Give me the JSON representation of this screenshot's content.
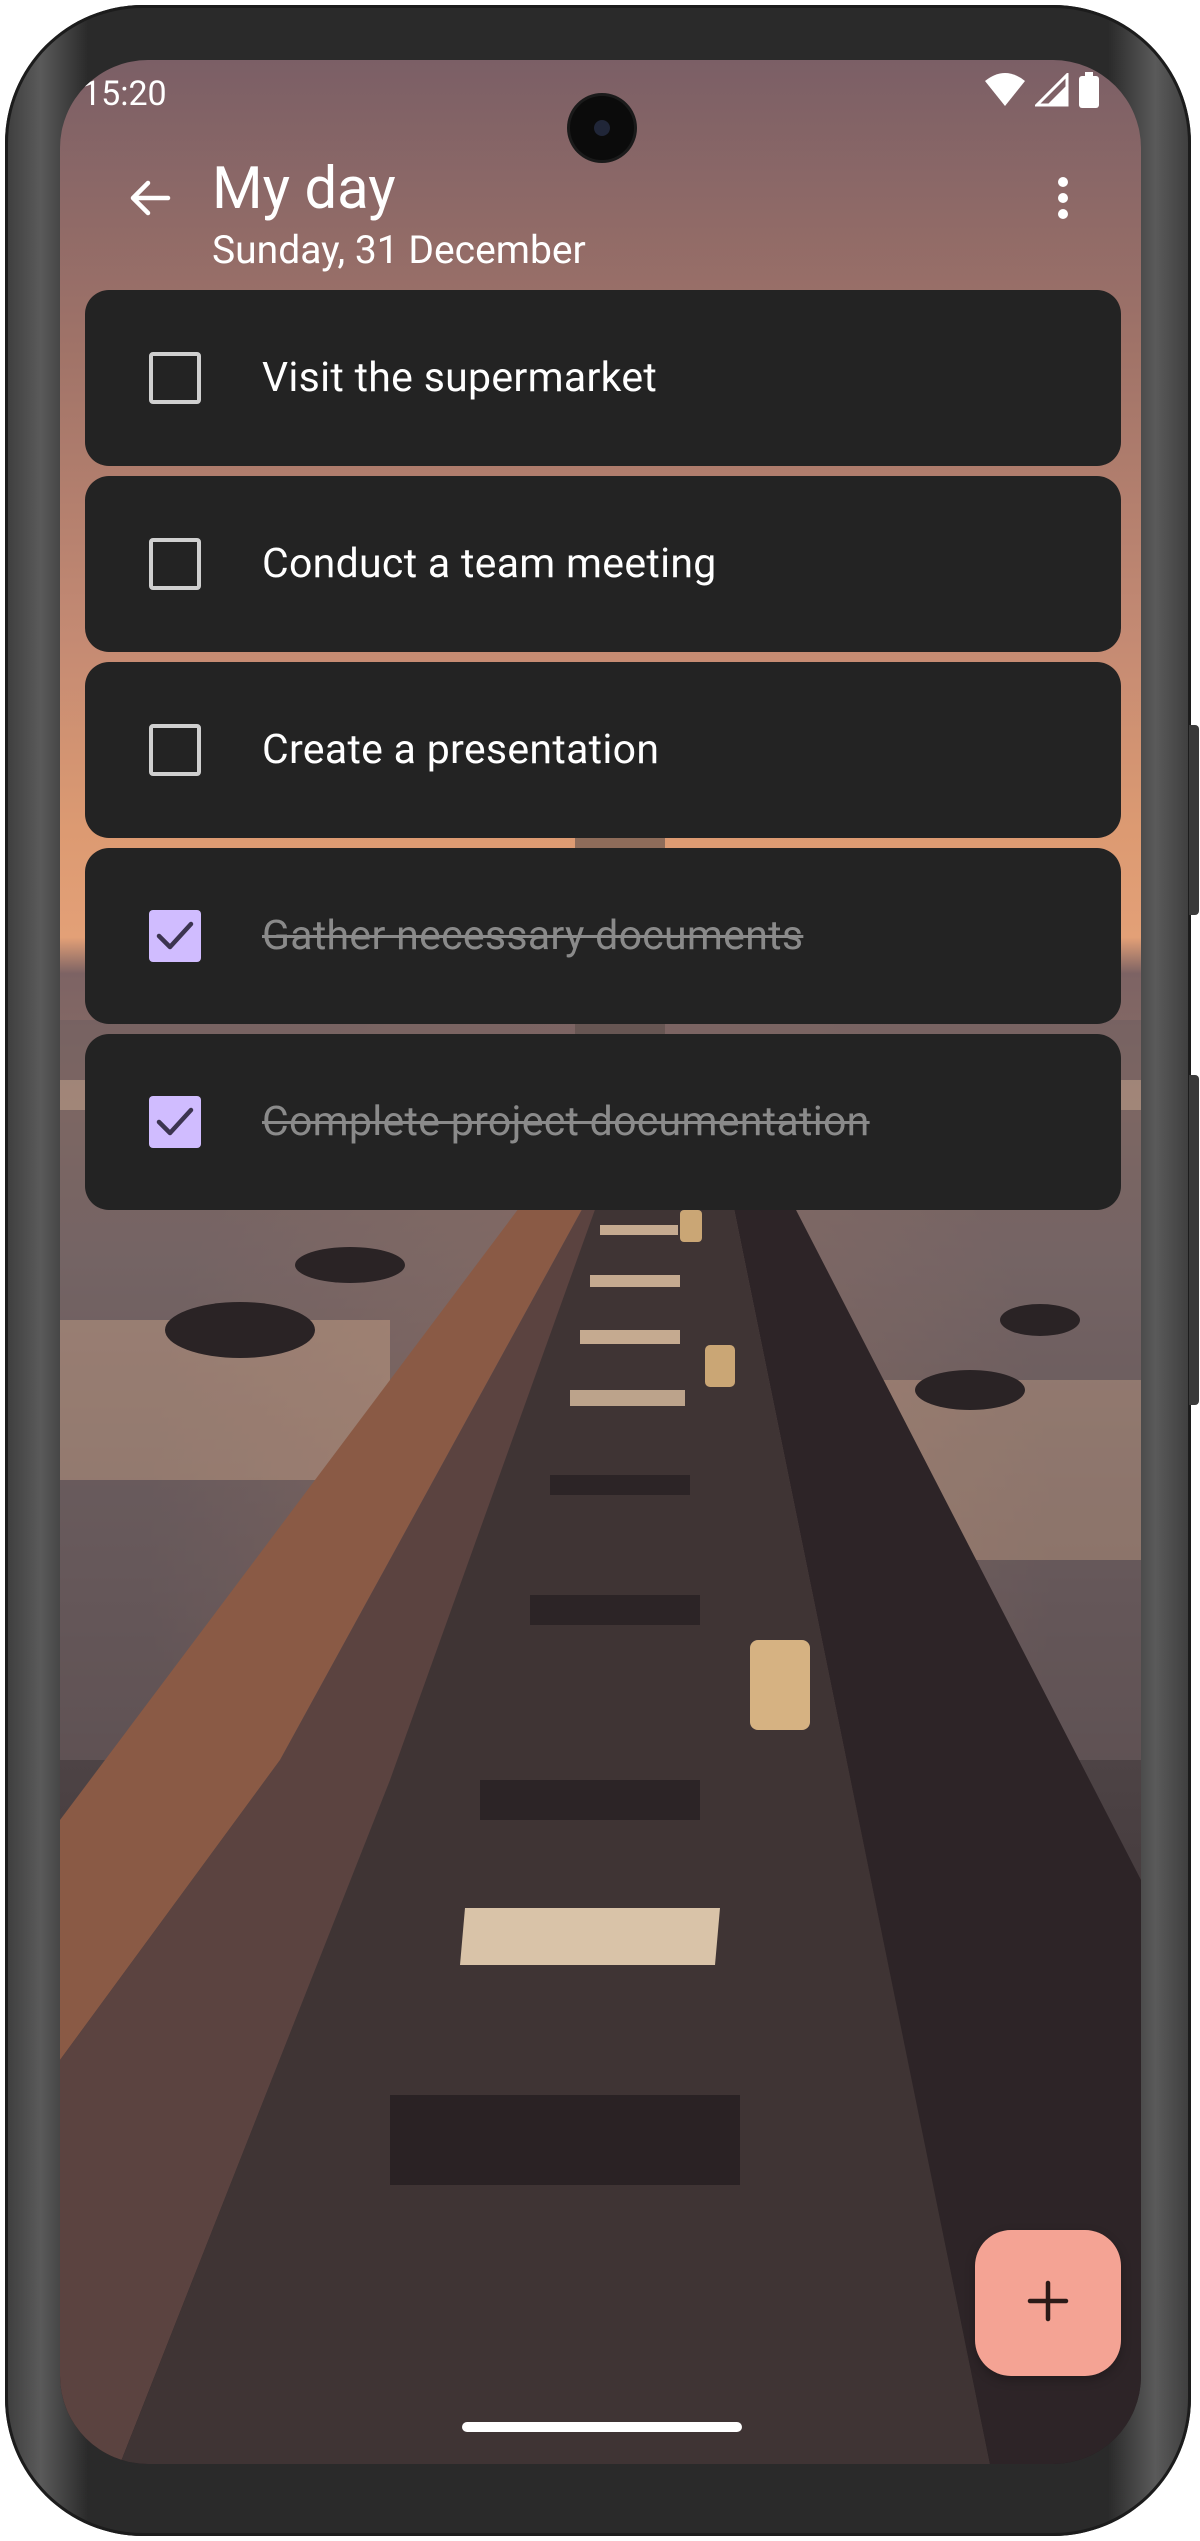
{
  "status_bar": {
    "time": "15:20"
  },
  "header": {
    "title": "My day",
    "subtitle": "Sunday, 31 December"
  },
  "tasks": [
    {
      "label": "Visit the supermarket",
      "completed": false
    },
    {
      "label": "Conduct a team meeting",
      "completed": false
    },
    {
      "label": "Create a presentation",
      "completed": false
    },
    {
      "label": "Gather necessary documents",
      "completed": true
    },
    {
      "label": "Complete project documentation",
      "completed": true
    }
  ],
  "icons": {
    "back": "arrow-back-icon",
    "more": "more-vert-icon",
    "fab": "add-icon",
    "wifi": "wifi-icon",
    "signal": "signal-icon",
    "battery": "battery-icon"
  },
  "colors": {
    "task_card": "#232323",
    "checkbox_checked": "#d0bcff",
    "fab": "#f4a394",
    "completed_text": "#8a8a8a"
  }
}
